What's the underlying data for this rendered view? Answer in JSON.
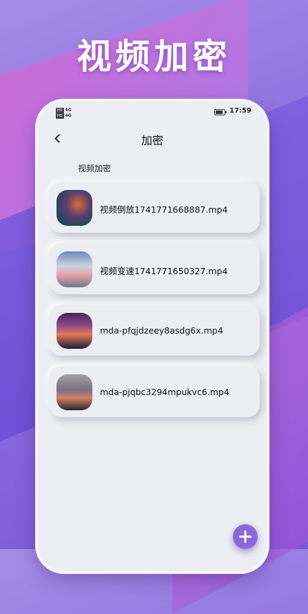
{
  "hero": {
    "title": "视频加密"
  },
  "status_bar": {
    "time": "17:59",
    "signal_top": "4G",
    "signal_bottom": "4G"
  },
  "nav": {
    "back_icon": "chevron-left-icon",
    "title": "加密"
  },
  "section": {
    "label": "视频加密"
  },
  "files": [
    {
      "name": "视频倒放1741771668887.mp4"
    },
    {
      "name": "视频变速1741771650327.mp4"
    },
    {
      "name": "mda-pfqjdzeey8asdg6x.mp4"
    },
    {
      "name": "mda-pjqbc3294mpukvc6.mp4"
    }
  ],
  "fab": {
    "icon": "plus-icon"
  },
  "colors": {
    "accent": "#8a6ad9",
    "background": "#eceef3"
  }
}
